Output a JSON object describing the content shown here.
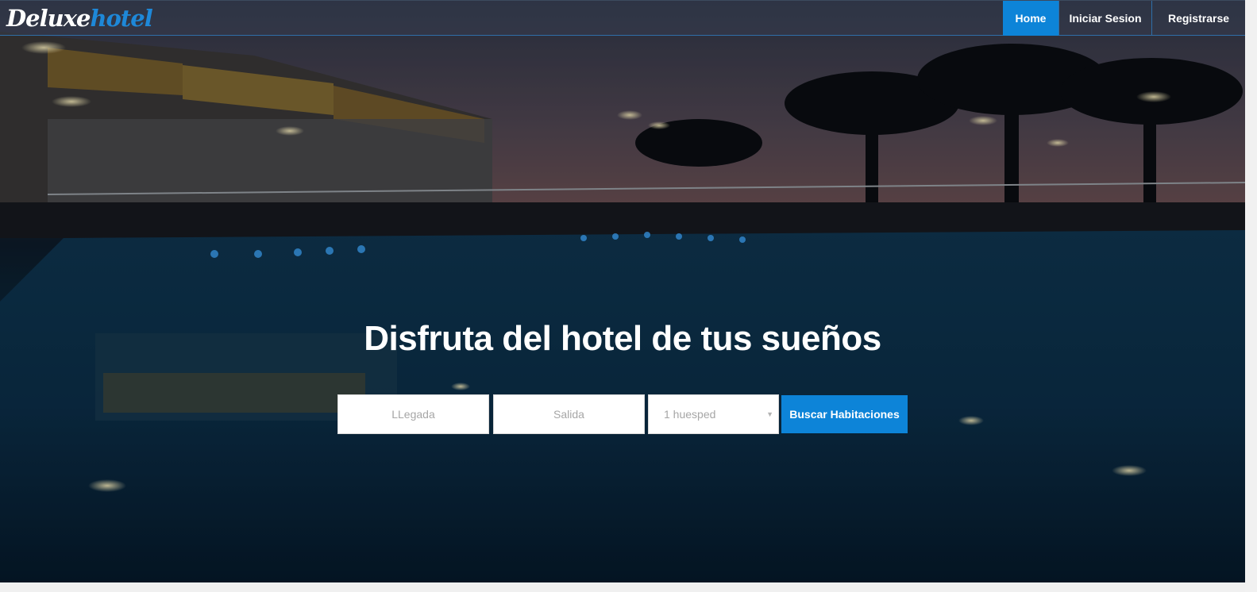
{
  "brand": {
    "part1": "Deluxe",
    "part2": "hotel"
  },
  "nav": {
    "items": [
      {
        "label": "Home",
        "active": true
      },
      {
        "label": "Iniciar Sesion",
        "active": false
      },
      {
        "label": "Registrarse",
        "active": false
      }
    ]
  },
  "hero": {
    "headline": "Disfruta del hotel de tus sueños"
  },
  "search": {
    "arrival_placeholder": "LLegada",
    "departure_placeholder": "Salida",
    "guests_value": "1 huesped",
    "submit_label": "Buscar Habitaciones"
  },
  "colors": {
    "accent": "#0d84d8",
    "brand_secondary": "#1e88d8"
  }
}
